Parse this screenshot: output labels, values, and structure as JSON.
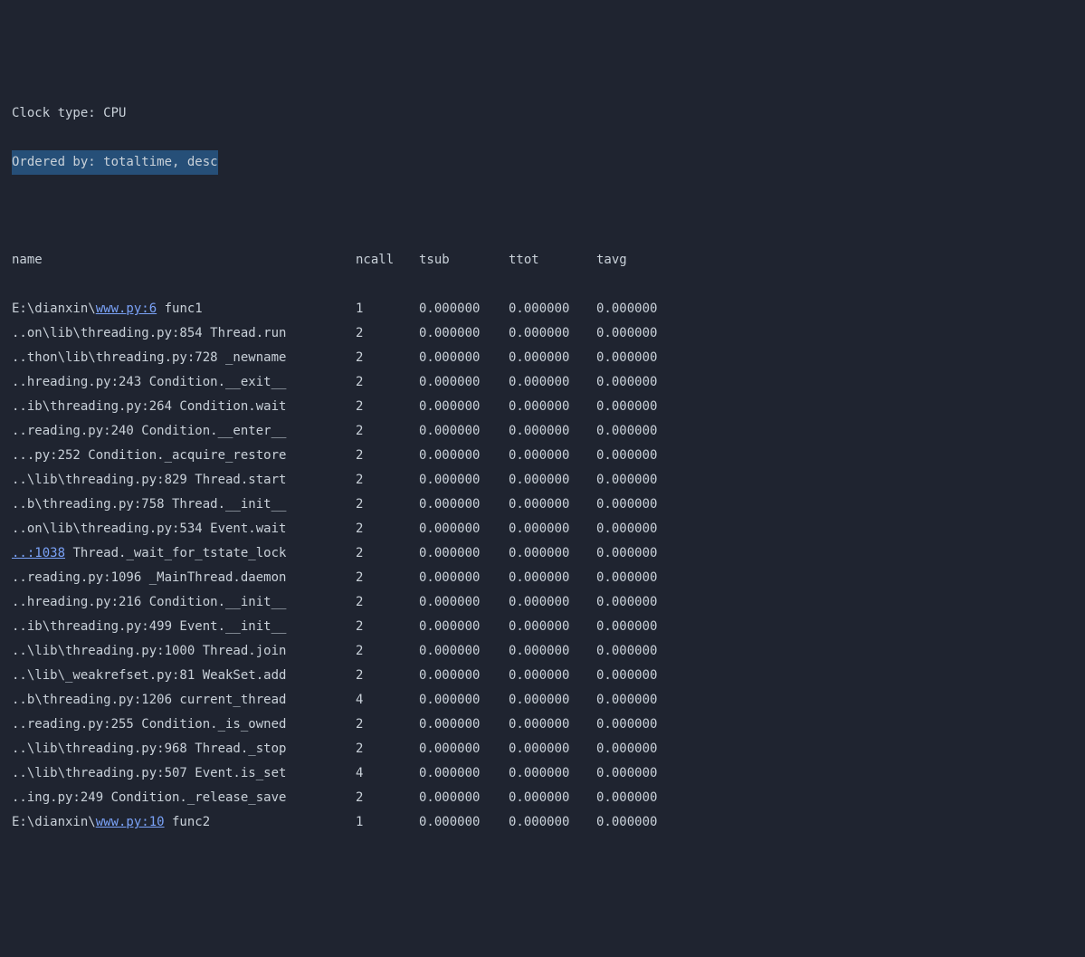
{
  "header": {
    "clock_line": "Clock type: CPU",
    "order_line": "Ordered by: totaltime, desc"
  },
  "columns": {
    "name": "name",
    "ncall": "ncall",
    "tsub": "tsub",
    "ttot": "ttot",
    "tavg": "tavg"
  },
  "rows": [
    {
      "prefix": "E:\\dianxin\\",
      "link": "www.py:6",
      "suffix": " func1",
      "ncall": "1",
      "tsub": "0.000000",
      "ttot": "0.000000",
      "tavg": "0.000000"
    },
    {
      "name": "..on\\lib\\threading.py:854 Thread.run",
      "ncall": "2",
      "tsub": "0.000000",
      "ttot": "0.000000",
      "tavg": "0.000000"
    },
    {
      "name": "..thon\\lib\\threading.py:728 _newname",
      "ncall": "2",
      "tsub": "0.000000",
      "ttot": "0.000000",
      "tavg": "0.000000"
    },
    {
      "name": "..hreading.py:243 Condition.__exit__",
      "ncall": "2",
      "tsub": "0.000000",
      "ttot": "0.000000",
      "tavg": "0.000000"
    },
    {
      "name": "..ib\\threading.py:264 Condition.wait",
      "ncall": "2",
      "tsub": "0.000000",
      "ttot": "0.000000",
      "tavg": "0.000000"
    },
    {
      "name": "..reading.py:240 Condition.__enter__",
      "ncall": "2",
      "tsub": "0.000000",
      "ttot": "0.000000",
      "tavg": "0.000000"
    },
    {
      "name": "...py:252 Condition._acquire_restore",
      "ncall": "2",
      "tsub": "0.000000",
      "ttot": "0.000000",
      "tavg": "0.000000"
    },
    {
      "name": "..\\lib\\threading.py:829 Thread.start",
      "ncall": "2",
      "tsub": "0.000000",
      "ttot": "0.000000",
      "tavg": "0.000000"
    },
    {
      "name": "..b\\threading.py:758 Thread.__init__",
      "ncall": "2",
      "tsub": "0.000000",
      "ttot": "0.000000",
      "tavg": "0.000000"
    },
    {
      "name": "..on\\lib\\threading.py:534 Event.wait",
      "ncall": "2",
      "tsub": "0.000000",
      "ttot": "0.000000",
      "tavg": "0.000000"
    },
    {
      "prefix": "",
      "link": "..:1038",
      "suffix": " Thread._wait_for_tstate_lock",
      "ncall": "2",
      "tsub": "0.000000",
      "ttot": "0.000000",
      "tavg": "0.000000"
    },
    {
      "name": "..reading.py:1096 _MainThread.daemon",
      "ncall": "2",
      "tsub": "0.000000",
      "ttot": "0.000000",
      "tavg": "0.000000"
    },
    {
      "name": "..hreading.py:216 Condition.__init__",
      "ncall": "2",
      "tsub": "0.000000",
      "ttot": "0.000000",
      "tavg": "0.000000"
    },
    {
      "name": "..ib\\threading.py:499 Event.__init__",
      "ncall": "2",
      "tsub": "0.000000",
      "ttot": "0.000000",
      "tavg": "0.000000"
    },
    {
      "name": "..\\lib\\threading.py:1000 Thread.join",
      "ncall": "2",
      "tsub": "0.000000",
      "ttot": "0.000000",
      "tavg": "0.000000"
    },
    {
      "name": "..\\lib\\_weakrefset.py:81 WeakSet.add",
      "ncall": "2",
      "tsub": "0.000000",
      "ttot": "0.000000",
      "tavg": "0.000000"
    },
    {
      "name": "..b\\threading.py:1206 current_thread",
      "ncall": "4",
      "tsub": "0.000000",
      "ttot": "0.000000",
      "tavg": "0.000000"
    },
    {
      "name": "..reading.py:255 Condition._is_owned",
      "ncall": "2",
      "tsub": "0.000000",
      "ttot": "0.000000",
      "tavg": "0.000000"
    },
    {
      "name": "..\\lib\\threading.py:968 Thread._stop",
      "ncall": "2",
      "tsub": "0.000000",
      "ttot": "0.000000",
      "tavg": "0.000000"
    },
    {
      "name": "..\\lib\\threading.py:507 Event.is_set",
      "ncall": "4",
      "tsub": "0.000000",
      "ttot": "0.000000",
      "tavg": "0.000000"
    },
    {
      "name": "..ing.py:249 Condition._release_save",
      "ncall": "2",
      "tsub": "0.000000",
      "ttot": "0.000000",
      "tavg": "0.000000"
    },
    {
      "prefix": "E:\\dianxin\\",
      "link": "www.py:10",
      "suffix": " func2",
      "ncall": "1",
      "tsub": "0.000000",
      "ttot": "0.000000",
      "tavg": "0.000000"
    }
  ]
}
